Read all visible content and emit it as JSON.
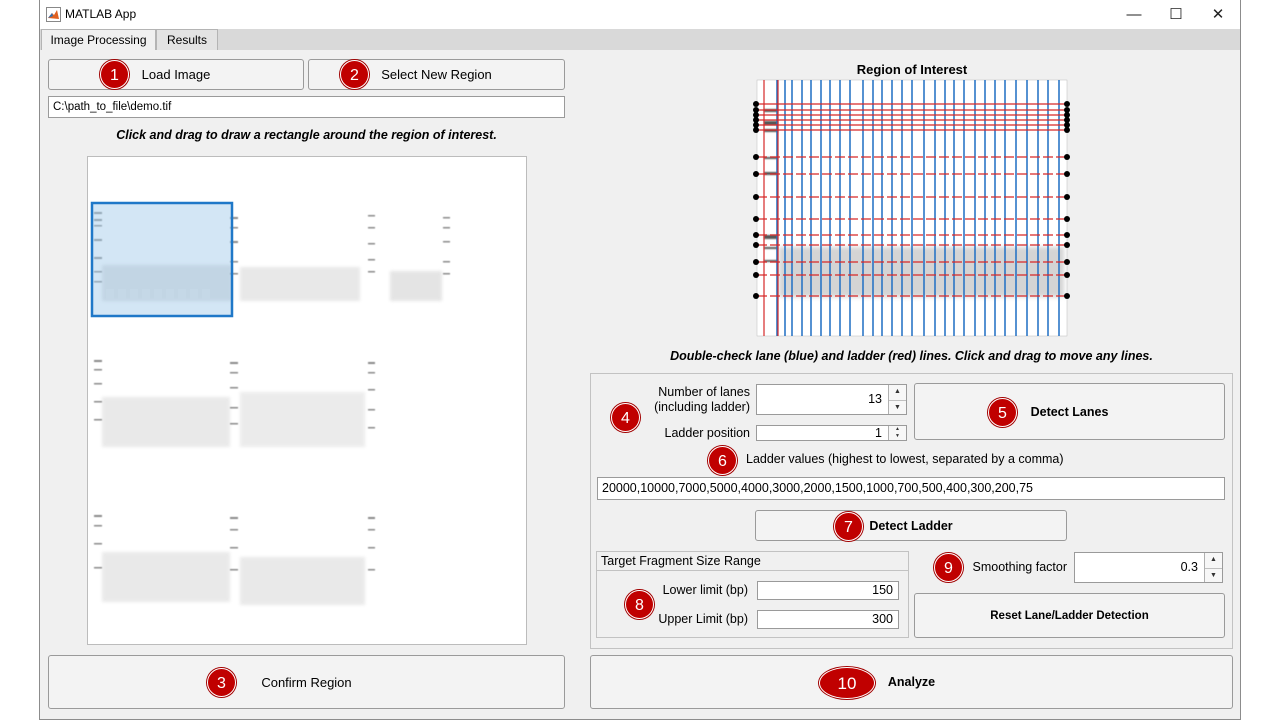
{
  "window": {
    "title": "MATLAB App",
    "controls": {
      "minimize": "—",
      "maximize": "☐",
      "close": "✕"
    }
  },
  "tabs": [
    {
      "label": "Image Processing",
      "active": true
    },
    {
      "label": "Results",
      "active": false
    }
  ],
  "left": {
    "load_image_label": "Load Image",
    "select_region_label": "Select New Region",
    "file_path": "C:\\path_to_file\\demo.tif",
    "instruction": "Click and drag to draw a rectangle around the region of interest.",
    "confirm_label": "Confirm Region"
  },
  "right": {
    "roi_title": "Region of Interest",
    "roi_instruction": "Double-check lane (blue) and ladder (red) lines. Click and drag to move any lines.",
    "num_lanes_label_1": "Number of lanes",
    "num_lanes_label_2": "(including ladder)",
    "num_lanes_value": "13",
    "ladder_position_label": "Ladder position",
    "ladder_position_value": "1",
    "detect_lanes_label": "Detect Lanes",
    "ladder_values_label": "Ladder values (highest to lowest, separated by a comma)",
    "ladder_values": "20000,10000,7000,5000,4000,3000,2000,1500,1000,700,500,400,300,200,75",
    "detect_ladder_label": "Detect Ladder",
    "target_range_title": "Target Fragment Size Range",
    "lower_limit_label": "Lower limit (bp)",
    "lower_limit_value": "150",
    "upper_limit_label": "Upper Limit (bp)",
    "upper_limit_value": "300",
    "smoothing_label": "Smoothing factor",
    "smoothing_value": "0.3",
    "reset_label": "Reset Lane/Ladder Detection",
    "analyze_label": "Analyze"
  },
  "badges": [
    "1",
    "2",
    "3",
    "4",
    "5",
    "6",
    "7",
    "8",
    "9",
    "10"
  ],
  "colors": {
    "badge": "#c00000",
    "lane_line": "#1f6fc4",
    "ladder_line": "#d62828",
    "selection": "#1f78c8"
  }
}
